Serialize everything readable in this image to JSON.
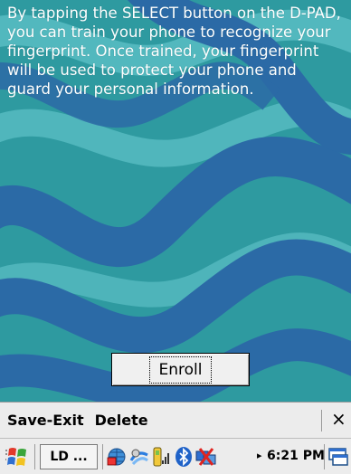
{
  "content": {
    "instructions": "By tapping the SELECT button on the D-PAD, you can train your phone to recognize your fingerprint. Once trained, your fingerprint will be used to protect your phone and guard your personal information.",
    "enroll_label": "Enroll"
  },
  "menubar": {
    "save_exit_label": "Save-Exit",
    "delete_label": "Delete",
    "close_label": "×"
  },
  "taskbar": {
    "start_icon": "windows-flag-icon",
    "task_label": "LD ...",
    "tray_icons": [
      "network-globe-icon",
      "sync-icon",
      "phone-signal-icon",
      "bluetooth-icon",
      "connection-icon"
    ],
    "arrow": "▸",
    "time": "6:21 PM",
    "end_icon": "desktop-icon"
  },
  "colors": {
    "background": "#2e9aa0",
    "wave_dark": "#2b6aa6",
    "wave_light": "#5fc2c8",
    "bar": "#ececec"
  }
}
